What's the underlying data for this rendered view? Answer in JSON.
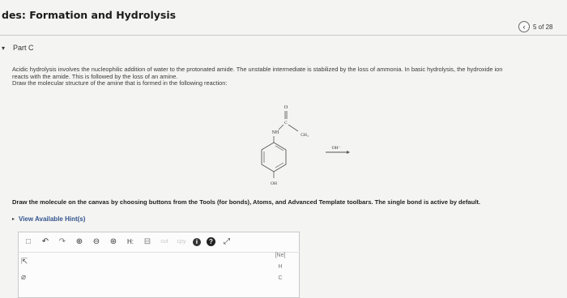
{
  "header": {
    "title": "des: Formation and Hydrolysis",
    "page_indicator": "5 of 28",
    "back_glyph": "‹"
  },
  "part": {
    "toggle_glyph": "▾",
    "label": "Part C"
  },
  "question": {
    "line1": "Acidic hydrolysis involves the nucleophilic addition of water to the protonated amide. The unstable intermediate is stabilized by the loss of ammonia. In basic hydrolysis, the hydroxide ion",
    "line2": "reacts with the amide. This is followed by the loss of an amine.",
    "line3": "Draw the molecular structure of the amine that is formed in the following reaction:"
  },
  "reaction": {
    "oxygen": "O",
    "carbon": "C",
    "nh": "NH",
    "ch3": "CH₃",
    "oh_bottom": "OH",
    "reagent": "OH⁻"
  },
  "instructions": "Draw the molecule on the canvas by choosing buttons from the Tools (for bonds), Atoms, and Advanced Template toolbars. The single bond is active by default.",
  "hints": {
    "toggle_glyph": "▸",
    "label": "View Available Hint(s)"
  },
  "toolbar": {
    "new_icon": "□",
    "undo_icon": "↶",
    "redo_icon": "↷",
    "zoom_in_icon": "⊕",
    "zoom_out_icon": "⊖",
    "zoom_fit_icon": "⊛",
    "hydrogens_label": "H:",
    "clean_icon": "⊟",
    "cut_label": "cut",
    "copy_label": "cpy",
    "info_icon": "i",
    "help_icon": "?",
    "expand_icon": "⤢"
  },
  "side_tools": {
    "select_icon": "⇱",
    "erase_icon": "⌀"
  },
  "atoms": {
    "label": "[Ne]",
    "h": "H",
    "c": "C"
  }
}
